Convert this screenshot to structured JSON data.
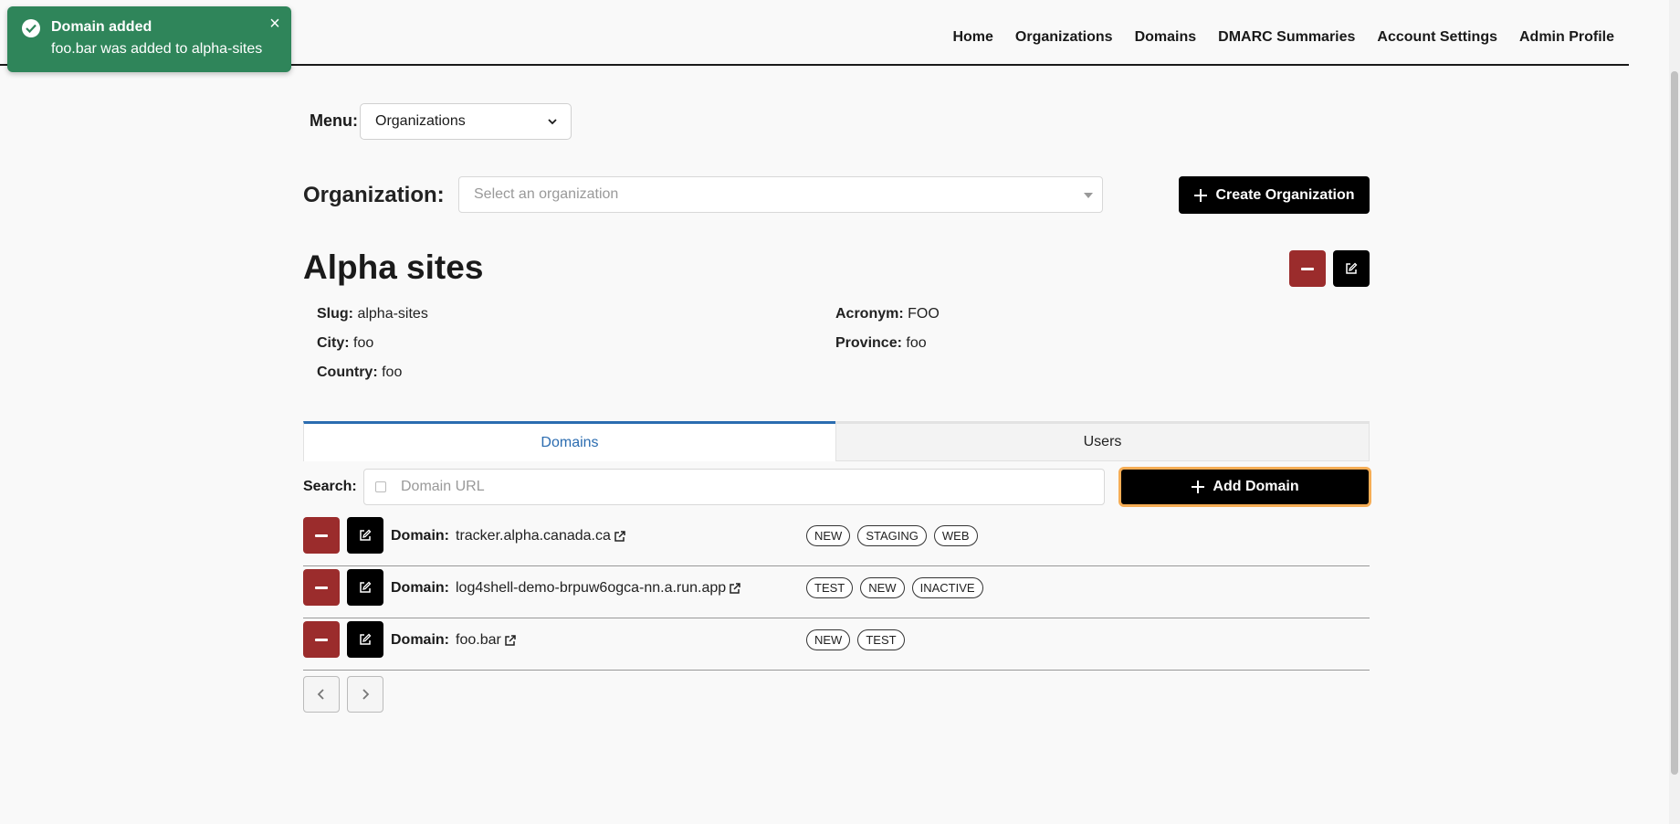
{
  "toast": {
    "title": "Domain added",
    "description": "foo.bar was added to alpha-sites",
    "close": "×"
  },
  "nav": {
    "items": [
      "Home",
      "Organizations",
      "Domains",
      "DMARC Summaries",
      "Account Settings",
      "Admin Profile"
    ]
  },
  "menu": {
    "label": "Menu:",
    "selected": "Organizations"
  },
  "organization": {
    "label": "Organization:",
    "placeholder": "Select an organization",
    "create_label": "Create Organization",
    "name": "Alpha sites",
    "details": {
      "slug_label": "Slug:",
      "slug": "alpha-sites",
      "acronym_label": "Acronym:",
      "acronym": "FOO",
      "city_label": "City:",
      "city": "foo",
      "province_label": "Province:",
      "province": "foo",
      "country_label": "Country:",
      "country": "foo"
    }
  },
  "tabs": [
    {
      "label": "Domains",
      "active": true
    },
    {
      "label": "Users",
      "active": false
    }
  ],
  "search": {
    "label": "Search:",
    "placeholder": "Domain URL",
    "add_label": "Add Domain"
  },
  "domains": [
    {
      "label": "Domain:",
      "url": "tracker.alpha.canada.ca",
      "tags": [
        "NEW",
        "STAGING",
        "WEB"
      ]
    },
    {
      "label": "Domain:",
      "url": "log4shell-demo-brpuw6ogca-nn.a.run.app",
      "tags": [
        "TEST",
        "NEW",
        "INACTIVE"
      ]
    },
    {
      "label": "Domain:",
      "url": "foo.bar",
      "tags": [
        "NEW",
        "TEST"
      ]
    }
  ],
  "colors": {
    "toast_green": "#2f855a",
    "danger_red": "#9b2c2c",
    "active_tab_blue": "#2b6cb0",
    "focus_orange": "#f6ad55"
  },
  "icons": [
    "check-circle-icon",
    "close-icon",
    "chevron-down-icon",
    "plus-icon",
    "minus-icon",
    "edit-icon",
    "external-link-icon",
    "chevron-left-icon",
    "chevron-right-icon"
  ]
}
